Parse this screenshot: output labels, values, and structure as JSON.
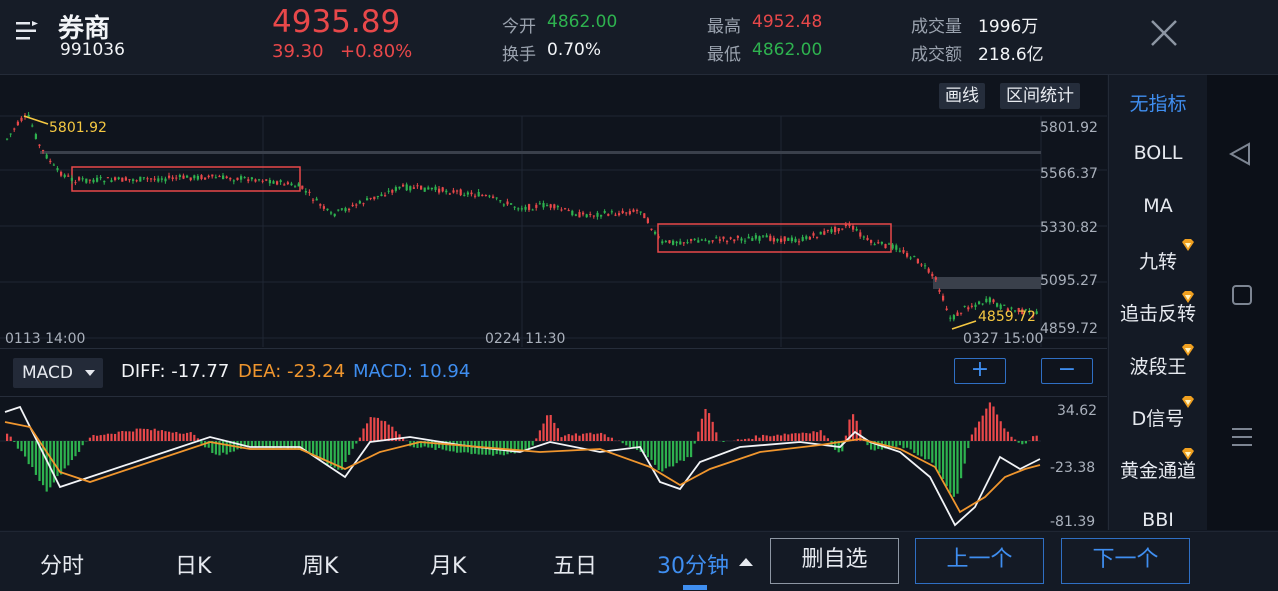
{
  "header": {
    "title": "券商",
    "code": "991036",
    "price": "4935.89",
    "change": "39.30",
    "change_pct": "+0.80%",
    "open_label": "今开",
    "open_value": "4862.00",
    "turnover_label": "换手",
    "turnover_value": "0.70%",
    "high_label": "最高",
    "high_value": "4952.48",
    "low_label": "最低",
    "low_value": "4862.00",
    "volume_label": "成交量",
    "volume_value": "1996万",
    "amount_label": "成交额",
    "amount_value": "218.6亿"
  },
  "toolbar": {
    "draw_label": "画线",
    "range_stats_label": "区间统计"
  },
  "main_chart": {
    "y_ticks": [
      "5801.92",
      "5566.37",
      "5330.82",
      "5095.27",
      "4859.72"
    ],
    "x_ticks": [
      "0113 14:00",
      "0224 11:30",
      "0327 15:00"
    ],
    "high_marker": "5801.92",
    "low_marker": "4859.72"
  },
  "macd": {
    "selector_label": "MACD",
    "diff_text": "DIFF: -17.77",
    "dea_text": "DEA: -23.24",
    "macd_text": "MACD: 10.94",
    "plus_label": "+",
    "minus_label": "−",
    "y_ticks": [
      "34.62",
      "-23.38",
      "-81.39"
    ]
  },
  "indicators": {
    "items": [
      "无指标",
      "BOLL",
      "MA",
      "九转",
      "追击反转",
      "波段王",
      "D信号",
      "黄金通道",
      "BBI"
    ]
  },
  "bottom": {
    "tabs": [
      "分时",
      "日K",
      "周K",
      "月K",
      "五日",
      "30分钟"
    ],
    "delete_fav": "删自选",
    "prev": "上一个",
    "next": "下一个"
  },
  "colors": {
    "up": "#e8484a",
    "down": "#2eb24f",
    "accent": "#3f8ef0",
    "dea_line": "#f0962e",
    "marker": "#f5c842"
  },
  "chart_data": {
    "type": "candlestick",
    "series": [
      {
        "name": "MACD",
        "ylim": [
          -81.39,
          34.62
        ]
      }
    ],
    "ylim": [
      4859.72,
      5801.92
    ],
    "x_ticks": [
      "0113 14:00",
      "0224 11:30",
      "0327 15:00"
    ]
  }
}
